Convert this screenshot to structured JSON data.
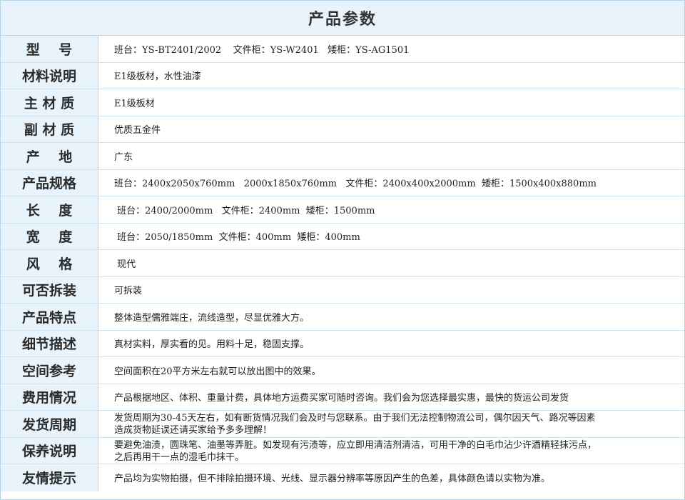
{
  "title": "产品参数",
  "rows": [
    {
      "label": "型    号",
      "value": "班台：YS-BT2401/2002    文件柜：YS-W2401   矮柜：YS-AG1501"
    },
    {
      "label": "材料说明",
      "value": "E1级板材，水性油漆"
    },
    {
      "label": "主 材 质",
      "value": "E1级板材"
    },
    {
      "label": "副 材 质",
      "value": "优质五金件"
    },
    {
      "label": "产    地",
      "value": "广东"
    },
    {
      "label": "产品规格",
      "value": "班台：2400x2050x760mm   2000x1850x760mm   文件柜：2400x400x2000mm  矮柜：1500x400x880mm"
    },
    {
      "label": "长    度",
      "value": " 班台：2400/2000mm   文件柜：2400mm  矮柜：1500mm"
    },
    {
      "label": "宽    度",
      "value": " 班台：2050/1850mm  文件柜：400mm  矮柜：400mm"
    },
    {
      "label": "风    格",
      "value": " 现代"
    },
    {
      "label": "可否拆装",
      "value": "可拆装"
    },
    {
      "label": "产品特点",
      "value": "整体造型儒雅端庄，流线造型，尽显优雅大方。"
    },
    {
      "label": "细节描述",
      "value": "真材实料，厚实看的见。用料十足，稳固支撑。"
    },
    {
      "label": "空间参考",
      "value": "空间面积在20平方米左右就可以放出图中的效果。"
    },
    {
      "label": "费用情况",
      "value": "产品根据地区、体积、重量计费，具体地方运费买家可随时咨询。我们会为您选择最实惠，最快的货运公司发货"
    },
    {
      "label": "发货周期",
      "value_lines": [
        "发货周期为30-45天左右，如有断货情况我们会及时与您联系。由于我们无法控制物流公司，偶尔因天气、路况等因素",
        "造成货物延误还请买家给予多多理解！"
      ]
    },
    {
      "label": "保养说明",
      "value_lines": [
        "要避免油渍，圆珠笔、油墨等弄脏。如发现有污渍等，应立即用清洁剂清洁，可用干净的白毛巾沾少许酒精轻抹污点，",
        "之后再用干一点的湿毛巾抹干。"
      ]
    },
    {
      "label": "友情提示",
      "value": "产品均为实物拍摄，但不排除拍摄环境、光线、显示器分辨率等原因产生的色差，具体颜色请以实物为准。"
    }
  ]
}
